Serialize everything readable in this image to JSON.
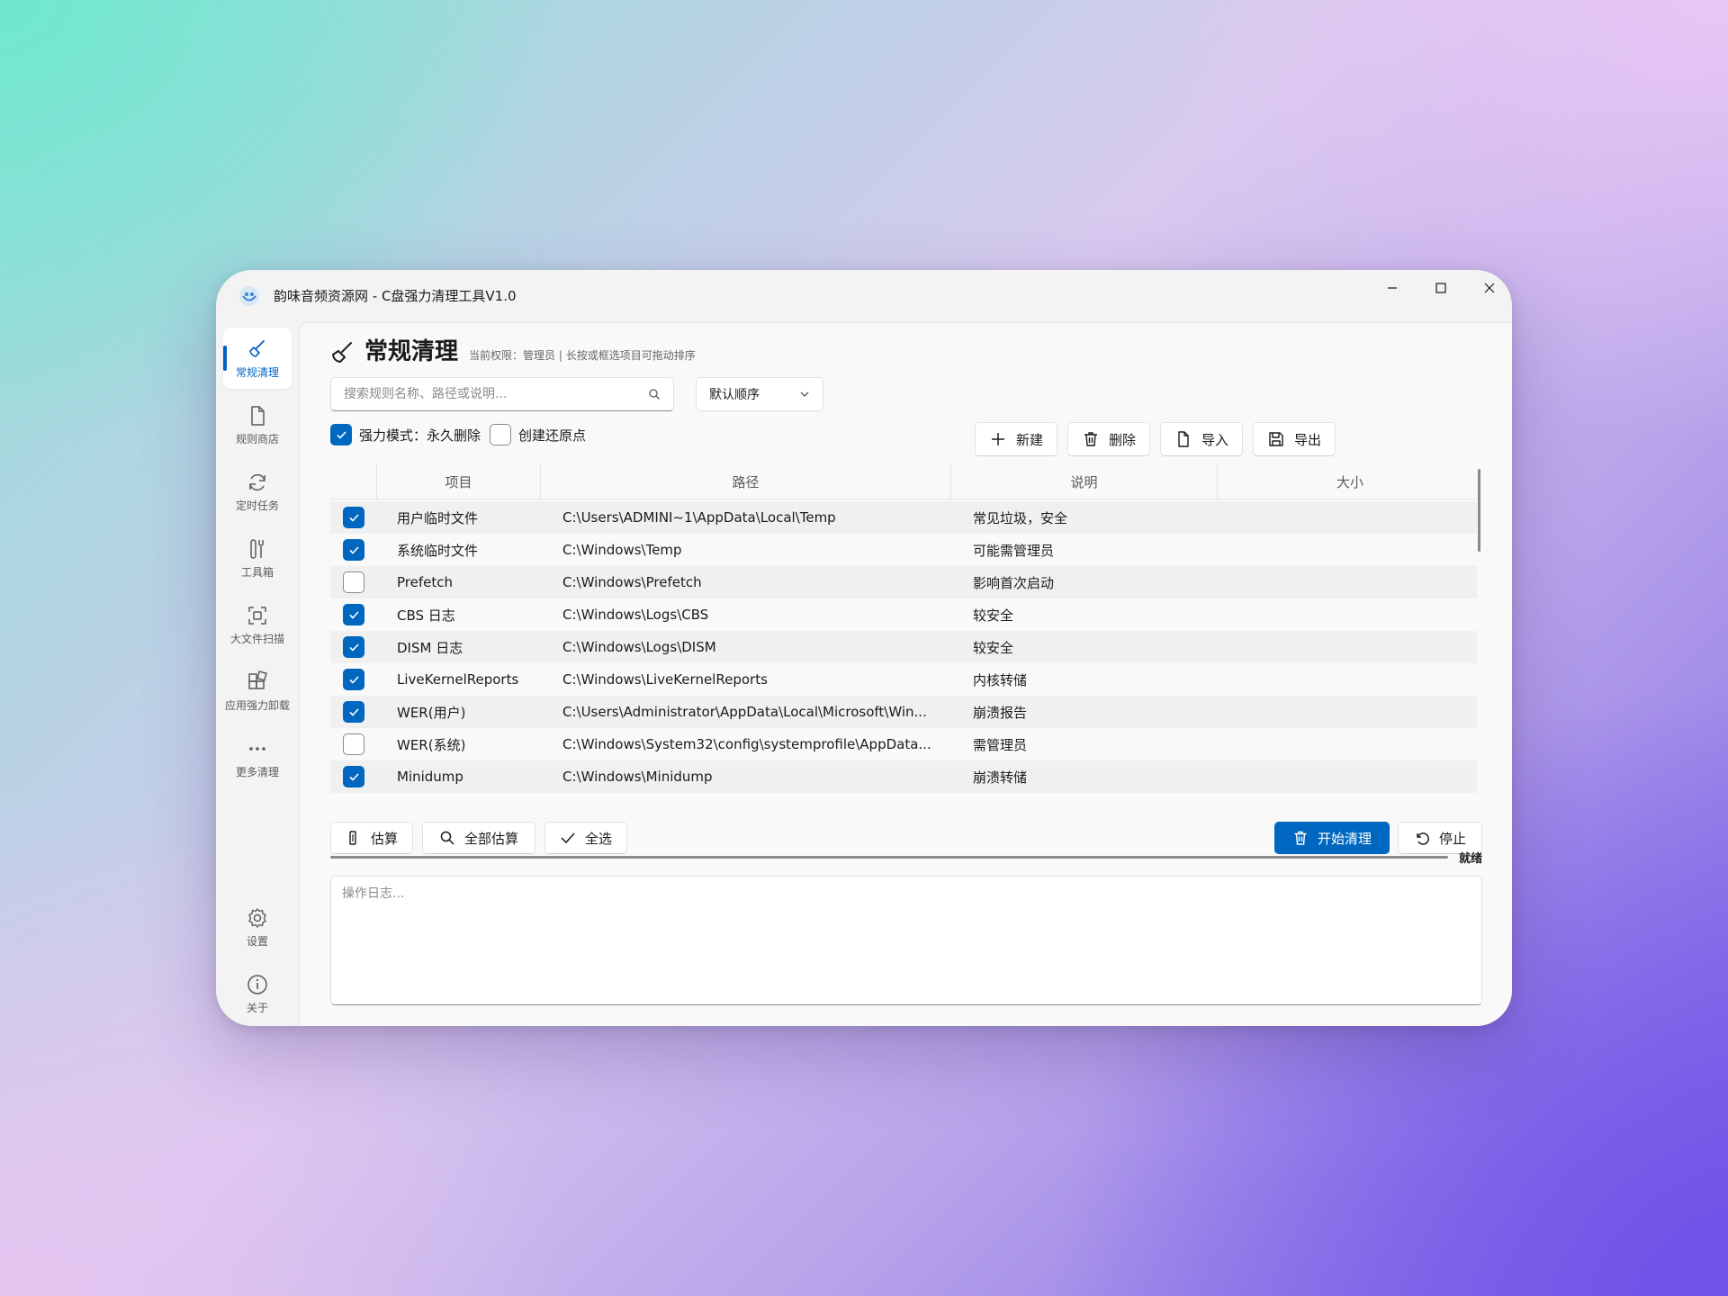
{
  "window": {
    "title": "韵味音频资源网 - C盘强力清理工具V1.0",
    "icon": "app-logo",
    "controls": [
      "minimize-icon",
      "maximize-icon",
      "close-icon"
    ]
  },
  "sidebar": {
    "items": [
      {
        "label": "常规清理",
        "icon": "broom-icon",
        "active": true
      },
      {
        "label": "规则商店",
        "icon": "document-icon",
        "active": false
      },
      {
        "label": "定时任务",
        "icon": "refresh-icon",
        "active": false
      },
      {
        "label": "工具箱",
        "icon": "tools-icon",
        "active": false
      },
      {
        "label": "大文件扫描",
        "icon": "scan-icon",
        "active": false
      },
      {
        "label": "应用强力卸载",
        "icon": "apps-icon",
        "active": false
      },
      {
        "label": "更多清理",
        "icon": "more-icon",
        "active": false
      }
    ],
    "footer": [
      {
        "label": "设置",
        "icon": "gear-icon"
      },
      {
        "label": "关于",
        "icon": "info-icon"
      }
    ]
  },
  "page": {
    "title": "常规清理",
    "hint": "当前权限：管理员 | 长按或框选项目可拖动排序"
  },
  "search": {
    "placeholder": "搜索规则名称、路径或说明...",
    "value": ""
  },
  "sort": {
    "selected": "默认顺序"
  },
  "options": {
    "force_mode": {
      "label": "强力模式：永久删除",
      "checked": true
    },
    "restore_point": {
      "label": "创建还原点",
      "checked": false
    }
  },
  "toolbar": {
    "new": "新建",
    "delete": "删除",
    "import": "导入",
    "export": "导出"
  },
  "table": {
    "columns": [
      "项目",
      "路径",
      "说明",
      "大小"
    ],
    "rows": [
      {
        "checked": true,
        "name": "用户临时文件",
        "path": "C:\\Users\\ADMINI~1\\AppData\\Local\\Temp",
        "desc": "常见垃圾，安全",
        "size": ""
      },
      {
        "checked": true,
        "name": "系统临时文件",
        "path": "C:\\Windows\\Temp",
        "desc": "可能需管理员",
        "size": ""
      },
      {
        "checked": false,
        "name": "Prefetch",
        "path": "C:\\Windows\\Prefetch",
        "desc": "影响首次启动",
        "size": ""
      },
      {
        "checked": true,
        "name": "CBS 日志",
        "path": "C:\\Windows\\Logs\\CBS",
        "desc": "较安全",
        "size": ""
      },
      {
        "checked": true,
        "name": "DISM 日志",
        "path": "C:\\Windows\\Logs\\DISM",
        "desc": "较安全",
        "size": ""
      },
      {
        "checked": true,
        "name": "LiveKernelReports",
        "path": "C:\\Windows\\LiveKernelReports",
        "desc": "内核转储",
        "size": ""
      },
      {
        "checked": true,
        "name": "WER(用户)",
        "path": "C:\\Users\\Administrator\\AppData\\Local\\Microsoft\\Win...",
        "desc": "崩溃报告",
        "size": ""
      },
      {
        "checked": false,
        "name": "WER(系统)",
        "path": "C:\\Windows\\System32\\config\\systemprofile\\AppData...",
        "desc": "需管理员",
        "size": ""
      },
      {
        "checked": true,
        "name": "Minidump",
        "path": "C:\\Windows\\Minidump",
        "desc": "崩溃转储",
        "size": ""
      }
    ]
  },
  "actions": {
    "estimate": "估算",
    "estimate_all": "全部估算",
    "select_all": "全选",
    "start": "开始清理",
    "stop": "停止"
  },
  "status": {
    "text": "就绪",
    "progress": 0
  },
  "log": {
    "placeholder": "操作日志...",
    "value": ""
  },
  "colors": {
    "accent": "#0067c0",
    "window_bg": "#f3f3f3",
    "content_bg": "#f9f9f9",
    "row_alt": "#f0f0f0"
  }
}
